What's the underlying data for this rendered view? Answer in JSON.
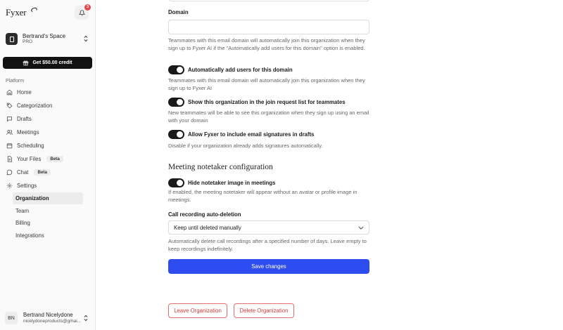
{
  "sidebar": {
    "logo": "Fyxer",
    "notifications_count": "3",
    "workspace": {
      "name": "Bertrand's Space",
      "plan": "PRO"
    },
    "credit_button": "Get $50.00 credit",
    "section_label": "Platform",
    "nav": [
      {
        "label": "Home",
        "icon": "home-icon"
      },
      {
        "label": "Categorization",
        "icon": "tag-icon"
      },
      {
        "label": "Drafts",
        "icon": "chat-bubble-icon"
      },
      {
        "label": "Meetings",
        "icon": "people-icon"
      },
      {
        "label": "Scheduling",
        "icon": "calendar-icon"
      },
      {
        "label": "Your Files",
        "icon": "file-icon",
        "badge": "Beta"
      },
      {
        "label": "Chat",
        "icon": "message-icon",
        "badge": "Beta"
      },
      {
        "label": "Settings",
        "icon": "gear-icon"
      }
    ],
    "settings_sub": [
      {
        "label": "Organization",
        "active": true
      },
      {
        "label": "Team"
      },
      {
        "label": "Billing"
      },
      {
        "label": "Integrations"
      }
    ],
    "user": {
      "initials": "BN",
      "name": "Bertrand Nicelydone",
      "email": "nicelydoneproducts@gmai..."
    }
  },
  "main": {
    "domain_label": "Domain",
    "domain_value": "",
    "domain_help": "Teammates with this email domain will automatically join this organization when they sign up to Fyxer AI if the \"Automatically add users for this domain\" option is enabled.",
    "toggles": [
      {
        "label": "Automatically add users for this domain",
        "on": true,
        "help": "Teammates with this email domain will automatically join this organization when they sign up to Fyxer AI"
      },
      {
        "label": "Show this organization in the join request list for teammates",
        "on": true,
        "help": "New teammates will be able to see this organization when they sign up using an email with your domain"
      },
      {
        "label": "Allow Fyxer to include email signatures in drafts",
        "on": true,
        "help": "Disable if your organization already adds signatures automatically."
      }
    ],
    "notetaker_title": "Meeting notetaker configuration",
    "notetaker_toggle": {
      "label": "Hide notetaker image in meetings",
      "on": true,
      "help": "If enabled, the meeting notetaker will appear without an avatar or profile image in meetings."
    },
    "recording_label": "Call recording auto-deletion",
    "recording_value": "Keep until deleted manually",
    "recording_help": "Automatically delete call recordings after a specified number of days. Leave empty to keep recordings indefinitely.",
    "save_button": "Save changes",
    "leave_button": "Leave Organization",
    "delete_button": "Delete Organization"
  },
  "colors": {
    "primary": "#2e4df0",
    "danger": "#d23d3d",
    "toggle_on": "#1a1a1a"
  }
}
